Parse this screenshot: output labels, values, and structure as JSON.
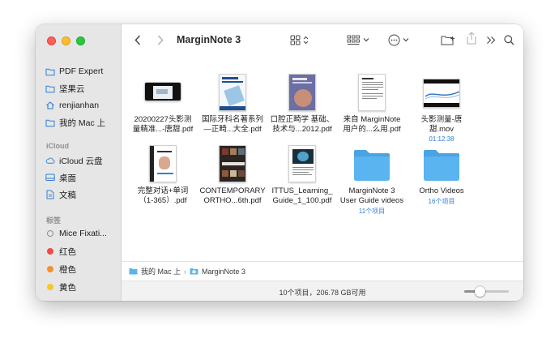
{
  "window": {
    "title": "MarginNote 3"
  },
  "sidebar": {
    "favorites": [
      {
        "label": "PDF Expert",
        "icon": "folder-icon"
      },
      {
        "label": "坚果云",
        "icon": "folder-icon"
      },
      {
        "label": "renjianhan",
        "icon": "home-icon"
      },
      {
        "label": "我的 Mac 上",
        "icon": "folder-icon"
      }
    ],
    "icloud_title": "iCloud",
    "icloud": [
      {
        "label": "iCloud 云盘",
        "icon": "cloud-icon"
      },
      {
        "label": "桌面",
        "icon": "desktop-icon"
      },
      {
        "label": "文稿",
        "icon": "document-icon"
      }
    ],
    "tags_title": "标签",
    "tags": [
      {
        "label": "Mice Fixati...",
        "color": ""
      },
      {
        "label": "红色",
        "color": "#f04a43"
      },
      {
        "label": "橙色",
        "color": "#f5912c"
      },
      {
        "label": "黄色",
        "color": "#f6c824"
      }
    ]
  },
  "files": [
    {
      "name_line1": "20200227头影测",
      "name_line2": "量精准...-唐甜.pdf",
      "sub": "",
      "type": "pdf-wide"
    },
    {
      "name_line1": "国际牙科名著系列",
      "name_line2": "—正畸...大全.pdf",
      "sub": "",
      "type": "pdf"
    },
    {
      "name_line1": "口腔正畸学 基础、",
      "name_line2": "技术与...2012.pdf",
      "sub": "",
      "type": "pdf"
    },
    {
      "name_line1": "来自 MarginNote",
      "name_line2": "用户的...么用.pdf",
      "sub": "",
      "type": "pdf"
    },
    {
      "name_line1": "头影测量-唐",
      "name_line2": "甜.mov",
      "sub": "01:12:38",
      "type": "video"
    },
    {
      "name_line1": "完整对话+单词",
      "name_line2": "（1-365）.pdf",
      "sub": "",
      "type": "pdf"
    },
    {
      "name_line1": "CONTEMPORARY",
      "name_line2": "ORTHO...6th.pdf",
      "sub": "",
      "type": "pdf"
    },
    {
      "name_line1": "ITTUS_Learning_",
      "name_line2": "Guide_1_100.pdf",
      "sub": "",
      "type": "pdf"
    },
    {
      "name_line1": "MarginNote 3",
      "name_line2": "User Guide videos",
      "sub": "11个项目",
      "type": "folder"
    },
    {
      "name_line1": "Ortho Videos",
      "name_line2": "",
      "sub": "16个项目",
      "type": "folder"
    }
  ],
  "pathbar": {
    "root": "我的 Mac 上",
    "separator": "›",
    "current": "MarginNote 3"
  },
  "status": {
    "text": "10个项目，206.78 GB可用",
    "zoom_fraction": 0.3
  },
  "colors": {
    "folder": "#5ab4ef",
    "folder_dark": "#4aa3e3",
    "accent": "#2f7fd9"
  }
}
